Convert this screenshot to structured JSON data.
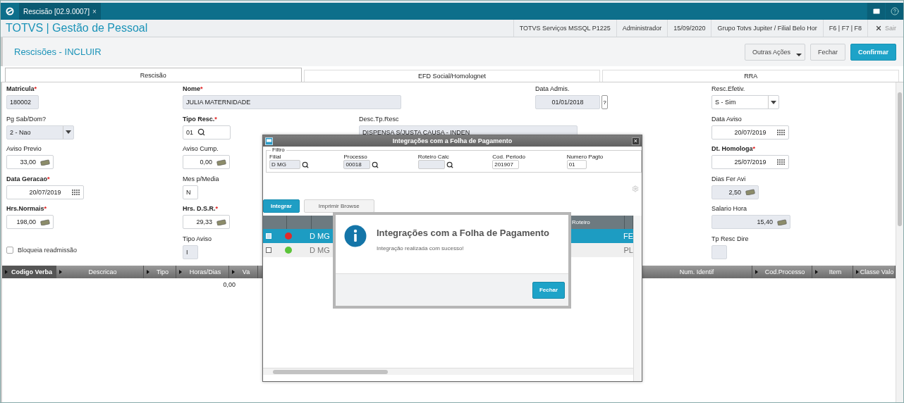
{
  "top_bar": {
    "tab": {
      "label": "Rescisão [02.9.0007]",
      "close": "×",
      "selected": true
    }
  },
  "header": {
    "app_title": "TOTVS | Gestão de Pessoal",
    "info": [
      "TOTVS Serviços MSSQL P1225",
      "Administrador",
      "15/09/2020",
      "Grupo Totvs Jupiter / Filial Belo Hor",
      "F6 | F7 | F8"
    ],
    "exit": "Sair"
  },
  "page": {
    "title": "Rescisões - INCLUIR",
    "actions": [
      {
        "label": "Outras Ações",
        "kind": "menu"
      },
      {
        "label": "Fechar",
        "kind": "default"
      },
      {
        "label": "Confirmar",
        "kind": "primary"
      }
    ]
  },
  "tabs": [
    {
      "label": "Rescisão",
      "selected": true
    },
    {
      "label": "EFD Social/Homolognet",
      "selected": false
    },
    {
      "label": "RRA",
      "selected": false
    }
  ],
  "form": {
    "required_mark": "*",
    "fields": [
      {
        "kind": "code",
        "label": "Matricula",
        "required": true,
        "value": "180002",
        "readonly": true
      },
      {
        "kind": "text",
        "label": "Nome",
        "required": true,
        "value": "JULIA MATERNIDADE",
        "readonly": true
      },
      {
        "kind": "date-help",
        "label": "Data Admis.",
        "required": false,
        "value": "01/01/2018",
        "readonly": true,
        "help": "?"
      },
      {
        "kind": "select",
        "label": "Resc.Efetiv.",
        "required": false,
        "value": "S - Sim",
        "readonly": false
      },
      {
        "kind": "select",
        "label": "Pg Sab/Dom?",
        "required": false,
        "value": "2 - Nao",
        "readonly": true
      },
      {
        "kind": "lookup",
        "label": "Tipo Resc.",
        "required": true,
        "value": "01",
        "readonly": false
      },
      {
        "kind": "text",
        "label": "Desc.Tp.Resc",
        "required": false,
        "value": "DISPENSA S/JUSTA CAUSA - INDEN",
        "readonly": true
      },
      {
        "kind": "date",
        "label": "Data Aviso",
        "required": false,
        "value": "20/07/2019",
        "readonly": false
      },
      {
        "kind": "number",
        "label": "Aviso Previo",
        "required": false,
        "value": "33,00",
        "readonly": false
      },
      {
        "kind": "number",
        "label": "Aviso Cump.",
        "required": false,
        "value": "0,00",
        "readonly": false
      },
      {
        "kind": "blank"
      },
      {
        "kind": "blank"
      },
      {
        "kind": "date",
        "label": "Dt. Homologa",
        "required": true,
        "value": "25/07/2019",
        "readonly": false
      },
      {
        "kind": "date",
        "label": "Data Geracao",
        "required": true,
        "value": "20/07/2019",
        "readonly": false
      },
      {
        "kind": "code",
        "label": "Mes p/Media",
        "required": false,
        "value": "N",
        "readonly": false
      },
      {
        "kind": "blank"
      },
      {
        "kind": "blank"
      },
      {
        "kind": "number",
        "label": "Dias Fer Avi",
        "required": false,
        "value": "2,50",
        "readonly": true
      },
      {
        "kind": "number",
        "label": "Hrs.Normais",
        "required": true,
        "value": "198,00",
        "readonly": false
      },
      {
        "kind": "number",
        "label": "Hrs. D.S.R.",
        "required": true,
        "value": "29,33",
        "readonly": false
      },
      {
        "kind": "blank"
      },
      {
        "kind": "blank"
      },
      {
        "kind": "amount",
        "label": "Salario Hora",
        "required": false,
        "value": "15,40",
        "readonly": true
      },
      {
        "kind": "checkbox",
        "label": "Bloqueia readmissão",
        "checked": false
      },
      {
        "kind": "code",
        "label": "Tipo Aviso",
        "required": false,
        "value": "I",
        "readonly": true
      },
      {
        "kind": "blank"
      },
      {
        "kind": "blank"
      },
      {
        "kind": "code",
        "label": "Tp Resc Dire",
        "required": false,
        "readonly": true
      }
    ]
  },
  "grid": {
    "columns": [
      {
        "label": "Codigo Verba",
        "selected": true
      },
      {
        "label": "Descricao",
        "selected": false
      },
      {
        "label": "Tipo",
        "selected": false
      },
      {
        "label": "Horas/Dias",
        "selected": false
      },
      {
        "label": "Va",
        "selected": false
      },
      {
        "label": "Num. Identif",
        "selected": false
      },
      {
        "label": "Cod.Processo",
        "selected": false
      },
      {
        "label": "Item",
        "selected": false
      },
      {
        "label": "Classe Valo",
        "selected": false
      }
    ],
    "rows": [
      {
        "horas_dias": "0,00"
      }
    ]
  },
  "dialog": {
    "title": "Integrações com a Folha de Pagamento",
    "close": "×",
    "filter": {
      "legend": "Filtro",
      "fields": [
        {
          "kind": "lookup",
          "label": "Filial",
          "value": "D MG",
          "readonly": true
        },
        {
          "kind": "lookup",
          "label": "Processo",
          "value": "00018",
          "readonly": true
        },
        {
          "kind": "lookup",
          "label": "Roteiro Calc",
          "readonly": true
        },
        {
          "kind": "text",
          "label": "Cod. Periodo",
          "value": "201907",
          "readonly": false
        },
        {
          "kind": "text",
          "label": "Numero Pagto",
          "value": "01",
          "readonly": false
        }
      ]
    },
    "buttons": [
      {
        "label": "Integrar",
        "kind": "primary"
      },
      {
        "label": "Imprimir Browse",
        "kind": "default"
      }
    ],
    "grid": {
      "column_header": "Roteiro",
      "rows": [
        {
          "selected": true,
          "checked": true,
          "color": "#e02b2b",
          "filial": "D MG",
          "column_last": "FE"
        },
        {
          "selected": false,
          "checked": false,
          "color": "#5cc43a",
          "filial": "D MG",
          "column_last": "PL"
        }
      ]
    }
  },
  "message": {
    "title": "Integrações com a Folha de Pagamento",
    "text": "Integração realizada com sucesso!",
    "button": "Fechar"
  }
}
